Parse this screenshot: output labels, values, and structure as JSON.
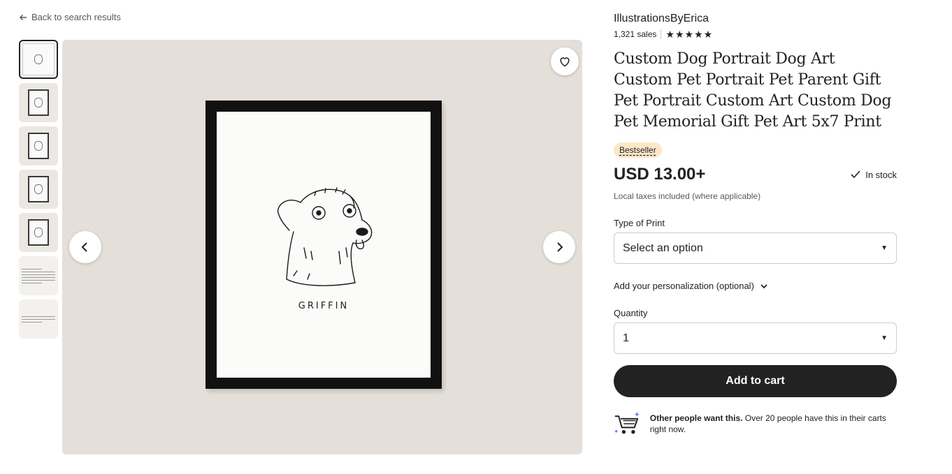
{
  "nav": {
    "back_label": "Back to search results"
  },
  "gallery": {
    "thumbnails": [
      "thumb-1",
      "thumb-2",
      "thumb-3",
      "thumb-4",
      "thumb-5",
      "thumb-6",
      "thumb-7"
    ],
    "selected_index": 0,
    "pet_name": "GRIFFIN"
  },
  "listing": {
    "shop_name": "IllustrationsByErica",
    "sales": "1,321 sales",
    "rating": 5,
    "title": "Custom Dog Portrait Dog Art Custom Pet Portrait Pet Parent Gift Pet Portrait Custom Art Custom Dog Pet Memorial Gift Pet Art 5x7 Print",
    "badge": "Bestseller",
    "price": "USD 13.00+",
    "stock": "In stock",
    "tax_note": "Local taxes included (where applicable)"
  },
  "options": {
    "print_type_label": "Type of Print",
    "print_type_value": "Select an option",
    "personalization_label": "Add your personalization (optional)",
    "quantity_label": "Quantity",
    "quantity_value": "1"
  },
  "actions": {
    "add_to_cart": "Add to cart"
  },
  "demand": {
    "bold": "Other people want this.",
    "text": " Over 20 people have this in their carts right now."
  },
  "colors": {
    "text": "#222222",
    "muted": "#595959",
    "badge_bg": "#fde7c8",
    "button_bg": "#222222",
    "image_bg": "#e4e0d9"
  },
  "icons": [
    "arrow-left-icon",
    "heart-icon",
    "chevron-left-icon",
    "chevron-right-icon",
    "star-icon",
    "check-icon",
    "caret-down-icon",
    "chevron-down-icon",
    "cart-sparkle-icon"
  ]
}
